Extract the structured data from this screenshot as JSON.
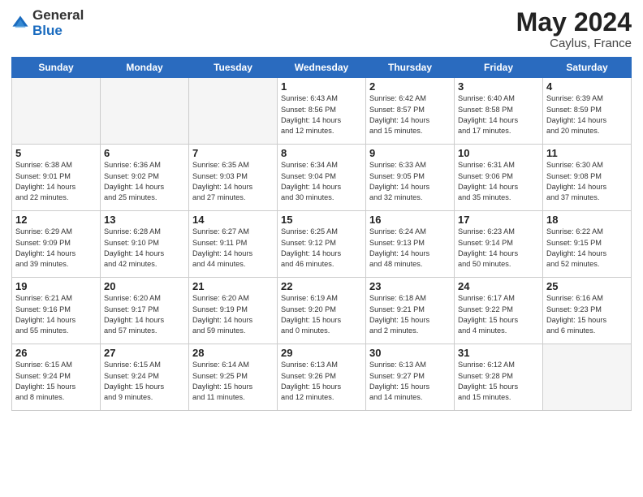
{
  "header": {
    "logo_general": "General",
    "logo_blue": "Blue",
    "title": "May 2024",
    "location": "Caylus, France"
  },
  "weekdays": [
    "Sunday",
    "Monday",
    "Tuesday",
    "Wednesday",
    "Thursday",
    "Friday",
    "Saturday"
  ],
  "weeks": [
    [
      {
        "day": "",
        "info": ""
      },
      {
        "day": "",
        "info": ""
      },
      {
        "day": "",
        "info": ""
      },
      {
        "day": "1",
        "info": "Sunrise: 6:43 AM\nSunset: 8:56 PM\nDaylight: 14 hours\nand 12 minutes."
      },
      {
        "day": "2",
        "info": "Sunrise: 6:42 AM\nSunset: 8:57 PM\nDaylight: 14 hours\nand 15 minutes."
      },
      {
        "day": "3",
        "info": "Sunrise: 6:40 AM\nSunset: 8:58 PM\nDaylight: 14 hours\nand 17 minutes."
      },
      {
        "day": "4",
        "info": "Sunrise: 6:39 AM\nSunset: 8:59 PM\nDaylight: 14 hours\nand 20 minutes."
      }
    ],
    [
      {
        "day": "5",
        "info": "Sunrise: 6:38 AM\nSunset: 9:01 PM\nDaylight: 14 hours\nand 22 minutes."
      },
      {
        "day": "6",
        "info": "Sunrise: 6:36 AM\nSunset: 9:02 PM\nDaylight: 14 hours\nand 25 minutes."
      },
      {
        "day": "7",
        "info": "Sunrise: 6:35 AM\nSunset: 9:03 PM\nDaylight: 14 hours\nand 27 minutes."
      },
      {
        "day": "8",
        "info": "Sunrise: 6:34 AM\nSunset: 9:04 PM\nDaylight: 14 hours\nand 30 minutes."
      },
      {
        "day": "9",
        "info": "Sunrise: 6:33 AM\nSunset: 9:05 PM\nDaylight: 14 hours\nand 32 minutes."
      },
      {
        "day": "10",
        "info": "Sunrise: 6:31 AM\nSunset: 9:06 PM\nDaylight: 14 hours\nand 35 minutes."
      },
      {
        "day": "11",
        "info": "Sunrise: 6:30 AM\nSunset: 9:08 PM\nDaylight: 14 hours\nand 37 minutes."
      }
    ],
    [
      {
        "day": "12",
        "info": "Sunrise: 6:29 AM\nSunset: 9:09 PM\nDaylight: 14 hours\nand 39 minutes."
      },
      {
        "day": "13",
        "info": "Sunrise: 6:28 AM\nSunset: 9:10 PM\nDaylight: 14 hours\nand 42 minutes."
      },
      {
        "day": "14",
        "info": "Sunrise: 6:27 AM\nSunset: 9:11 PM\nDaylight: 14 hours\nand 44 minutes."
      },
      {
        "day": "15",
        "info": "Sunrise: 6:25 AM\nSunset: 9:12 PM\nDaylight: 14 hours\nand 46 minutes."
      },
      {
        "day": "16",
        "info": "Sunrise: 6:24 AM\nSunset: 9:13 PM\nDaylight: 14 hours\nand 48 minutes."
      },
      {
        "day": "17",
        "info": "Sunrise: 6:23 AM\nSunset: 9:14 PM\nDaylight: 14 hours\nand 50 minutes."
      },
      {
        "day": "18",
        "info": "Sunrise: 6:22 AM\nSunset: 9:15 PM\nDaylight: 14 hours\nand 52 minutes."
      }
    ],
    [
      {
        "day": "19",
        "info": "Sunrise: 6:21 AM\nSunset: 9:16 PM\nDaylight: 14 hours\nand 55 minutes."
      },
      {
        "day": "20",
        "info": "Sunrise: 6:20 AM\nSunset: 9:17 PM\nDaylight: 14 hours\nand 57 minutes."
      },
      {
        "day": "21",
        "info": "Sunrise: 6:20 AM\nSunset: 9:19 PM\nDaylight: 14 hours\nand 59 minutes."
      },
      {
        "day": "22",
        "info": "Sunrise: 6:19 AM\nSunset: 9:20 PM\nDaylight: 15 hours\nand 0 minutes."
      },
      {
        "day": "23",
        "info": "Sunrise: 6:18 AM\nSunset: 9:21 PM\nDaylight: 15 hours\nand 2 minutes."
      },
      {
        "day": "24",
        "info": "Sunrise: 6:17 AM\nSunset: 9:22 PM\nDaylight: 15 hours\nand 4 minutes."
      },
      {
        "day": "25",
        "info": "Sunrise: 6:16 AM\nSunset: 9:23 PM\nDaylight: 15 hours\nand 6 minutes."
      }
    ],
    [
      {
        "day": "26",
        "info": "Sunrise: 6:15 AM\nSunset: 9:24 PM\nDaylight: 15 hours\nand 8 minutes."
      },
      {
        "day": "27",
        "info": "Sunrise: 6:15 AM\nSunset: 9:24 PM\nDaylight: 15 hours\nand 9 minutes."
      },
      {
        "day": "28",
        "info": "Sunrise: 6:14 AM\nSunset: 9:25 PM\nDaylight: 15 hours\nand 11 minutes."
      },
      {
        "day": "29",
        "info": "Sunrise: 6:13 AM\nSunset: 9:26 PM\nDaylight: 15 hours\nand 12 minutes."
      },
      {
        "day": "30",
        "info": "Sunrise: 6:13 AM\nSunset: 9:27 PM\nDaylight: 15 hours\nand 14 minutes."
      },
      {
        "day": "31",
        "info": "Sunrise: 6:12 AM\nSunset: 9:28 PM\nDaylight: 15 hours\nand 15 minutes."
      },
      {
        "day": "",
        "info": ""
      }
    ]
  ]
}
